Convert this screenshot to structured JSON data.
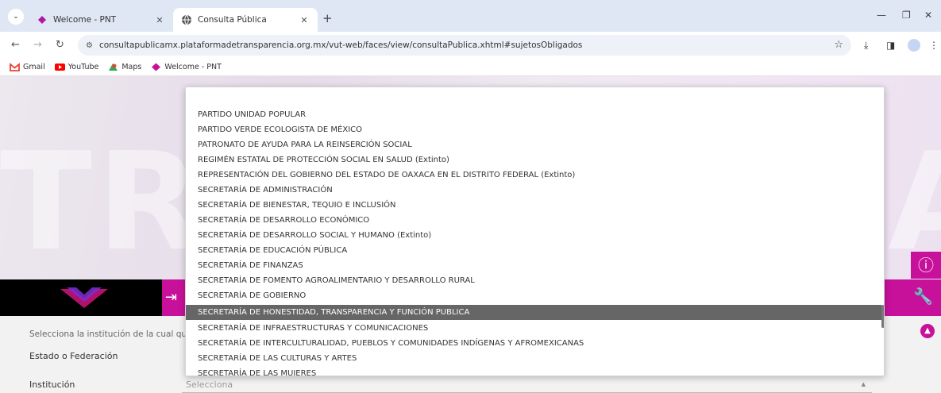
{
  "browser": {
    "tabs": [
      {
        "title": "Welcome - PNT",
        "active": false
      },
      {
        "title": "Consulta Pública",
        "active": true
      }
    ],
    "url": "consultapublicamx.plataformadetransparencia.org.mx/vut-web/faces/view/consultaPublica.xhtml#sujetosObligados",
    "bookmarks": [
      "Gmail",
      "YouTube",
      "Maps",
      "Welcome - PNT"
    ]
  },
  "page": {
    "hint": "Selecciona la institución de la cual qu",
    "estado_label": "Estado o Federación",
    "institucion_label": "Institución",
    "institucion_value": "Selecciona"
  },
  "dropdown": {
    "options": [
      "PARTIDO UNIDAD POPULAR",
      "PARTIDO VERDE ECOLOGISTA DE MÉXICO",
      "PATRONATO DE AYUDA PARA LA REINSERCIÓN SOCIAL",
      "REGIMÉN ESTATAL DE PROTECCIÓN SOCIAL EN SALUD (Extinto)",
      "REPRESENTACIÓN DEL GOBIERNO DEL ESTADO DE OAXACA EN EL DISTRITO FEDERAL (Extinto)",
      "SECRETARÍA DE ADMINISTRACIÓN",
      "SECRETARÍA DE BIENESTAR, TEQUIO E INCLUSIÓN",
      "SECRETARÍA DE DESARROLLO ECONÓMICO",
      "SECRETARÍA DE DESARROLLO SOCIAL Y HUMANO (Extinto)",
      "SECRETARÍA DE EDUCACIÓN PÚBLICA",
      "SECRETARÍA DE FINANZAS",
      "SECRETARÍA DE FOMENTO AGROALIMENTARIO Y DESARROLLO RURAL",
      "SECRETARÍA DE GOBIERNO",
      "SECRETARÍA DE HONESTIDAD, TRANSPARENCIA Y FUNCIÓN PUBLICA",
      "SECRETARÍA DE INFRAESTRUCTURAS Y COMUNICACIONES",
      "SECRETARÍA DE INTERCULTURALIDAD, PUEBLOS Y COMUNIDADES INDÍGENAS Y AFROMEXICANAS",
      "SECRETARÍA DE LAS CULTURAS Y ARTES",
      "SECRETARÍA DE LAS MUJERES"
    ],
    "selected_index": 13
  },
  "colors": {
    "accent": "#c8119b",
    "selected_option_bg": "#666666"
  }
}
